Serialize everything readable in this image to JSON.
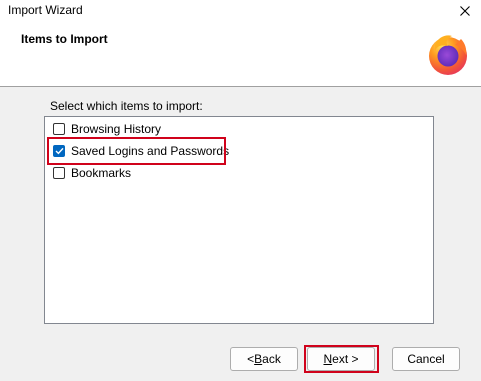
{
  "window": {
    "title": "Import Wizard",
    "close_glyph": "✕"
  },
  "header": {
    "title": "Items to Import",
    "logo_icon": "firefox-logo"
  },
  "main": {
    "prompt": "Select which items to import:",
    "items": [
      {
        "label": "Browsing History",
        "checked": false,
        "highlighted": false
      },
      {
        "label": "Saved Logins and Passwords",
        "checked": true,
        "highlighted": true
      },
      {
        "label": "Bookmarks",
        "checked": false,
        "highlighted": false
      }
    ]
  },
  "buttons": {
    "back": {
      "prefix": "< ",
      "mnemonic": "B",
      "rest": "ack"
    },
    "next": {
      "prefix": "",
      "mnemonic": "N",
      "rest": "ext >"
    },
    "cancel": {
      "label": "Cancel"
    }
  },
  "colors": {
    "highlight": "#d0021b",
    "check_accent": "#0067c0"
  }
}
